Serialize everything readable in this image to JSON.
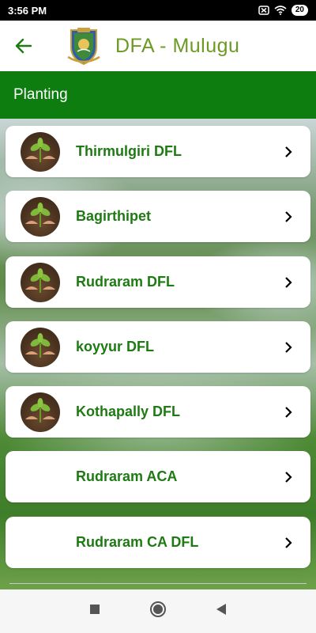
{
  "status_bar": {
    "time": "3:56 PM",
    "battery": "20"
  },
  "app_bar": {
    "title": "DFA - Mulugu"
  },
  "section": {
    "title": "Planting"
  },
  "items": [
    {
      "label": "Thirmulgiri DFL",
      "has_image": true
    },
    {
      "label": "Bagirthipet",
      "has_image": true
    },
    {
      "label": "Rudraram DFL",
      "has_image": true
    },
    {
      "label": "koyyur DFL",
      "has_image": true
    },
    {
      "label": "Kothapally DFL",
      "has_image": true
    },
    {
      "label": "Rudraram ACA",
      "has_image": false
    },
    {
      "label": "Rudraram CA DFL",
      "has_image": false
    }
  ],
  "colors": {
    "header": "#0d7d10",
    "title": "#6c9a22",
    "label": "#1e7a12"
  }
}
